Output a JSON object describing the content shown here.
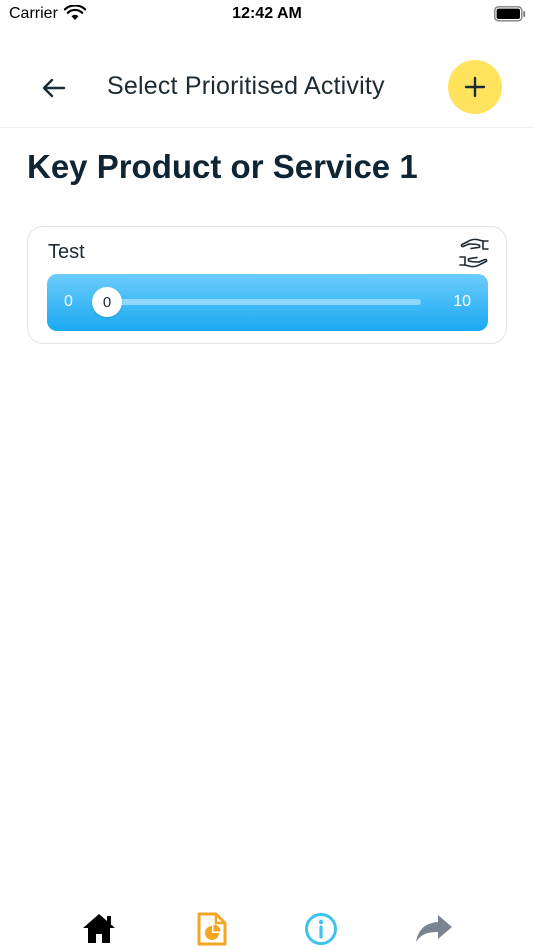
{
  "status_bar": {
    "carrier": "Carrier",
    "time": "12:42 AM"
  },
  "nav": {
    "title": "Select Prioritised Activity",
    "back_icon": "arrow-left-icon",
    "add_icon": "plus-icon",
    "add_color": "#ffe35c"
  },
  "page": {
    "heading": "Key Product or Service 1"
  },
  "activity": {
    "title": "Test",
    "icon": "hands-icon",
    "slider": {
      "min_label": "0",
      "max_label": "10",
      "min": 0,
      "max": 10,
      "value": 0,
      "value_label": "0",
      "color": "#1aa9f2"
    }
  },
  "tabs": [
    {
      "icon": "home-icon",
      "color": "#000000"
    },
    {
      "icon": "report-icon",
      "color": "#f5a623"
    },
    {
      "icon": "info-icon",
      "color": "#3ec3ee"
    },
    {
      "icon": "share-icon",
      "color": "#7a8390"
    }
  ]
}
